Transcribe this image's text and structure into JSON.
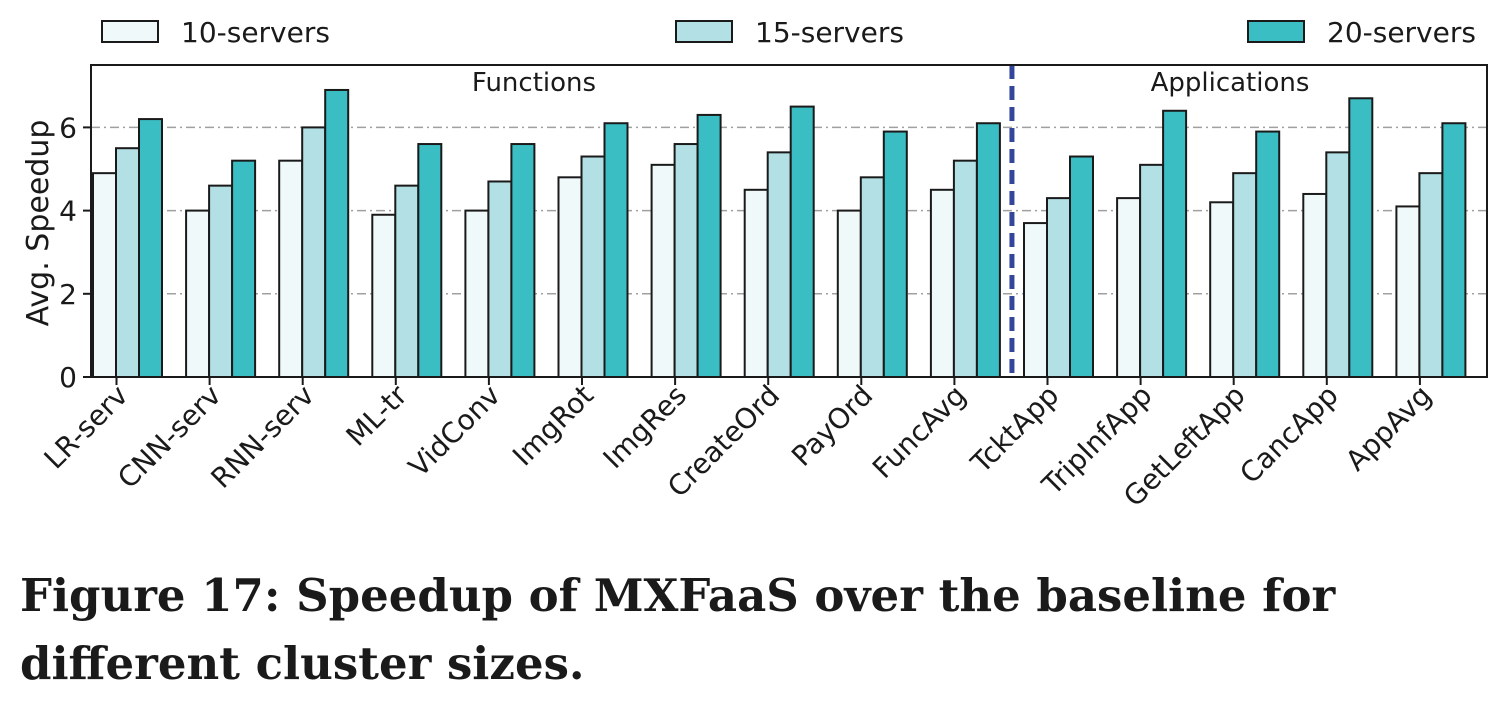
{
  "chart_data": {
    "type": "bar",
    "ylabel": "Avg. Speedup",
    "ylim": [
      0,
      7.5
    ],
    "yticks": [
      0,
      2,
      4,
      6
    ],
    "grid": "horizontal dash-dot at y ticks",
    "legend_placement": "top, above plot",
    "categories": [
      "LR-serv",
      "CNN-serv",
      "RNN-serv",
      "ML-tr",
      "VidConv",
      "ImgRot",
      "ImgRes",
      "CreateOrd",
      "PayOrd",
      "FuncAvg",
      "TcktApp",
      "TripInfApp",
      "GetLeftApp",
      "CancApp",
      "AppAvg"
    ],
    "series": [
      {
        "name": "10-servers",
        "color": "#f0f9fa",
        "values": [
          4.9,
          4.0,
          5.2,
          3.9,
          4.0,
          4.8,
          5.1,
          4.5,
          4.0,
          4.5,
          3.7,
          4.3,
          4.2,
          4.4,
          4.1
        ]
      },
      {
        "name": "15-servers",
        "color": "#b2e0e4",
        "values": [
          5.5,
          4.6,
          6.0,
          4.6,
          4.7,
          5.3,
          5.6,
          5.4,
          4.8,
          5.2,
          4.3,
          5.1,
          4.9,
          5.4,
          4.9
        ]
      },
      {
        "name": "20-servers",
        "color": "#3bbdc4",
        "values": [
          6.2,
          5.2,
          6.9,
          5.6,
          5.6,
          6.1,
          6.3,
          6.5,
          5.9,
          6.1,
          5.3,
          6.4,
          5.9,
          6.7,
          6.1
        ]
      }
    ],
    "sections": [
      {
        "label": "Functions"
      },
      {
        "label": "Applications"
      }
    ],
    "divider_color": "#34469b"
  },
  "caption": "Figure 17: Speedup of MXFaaS over the baseline for different cluster sizes."
}
